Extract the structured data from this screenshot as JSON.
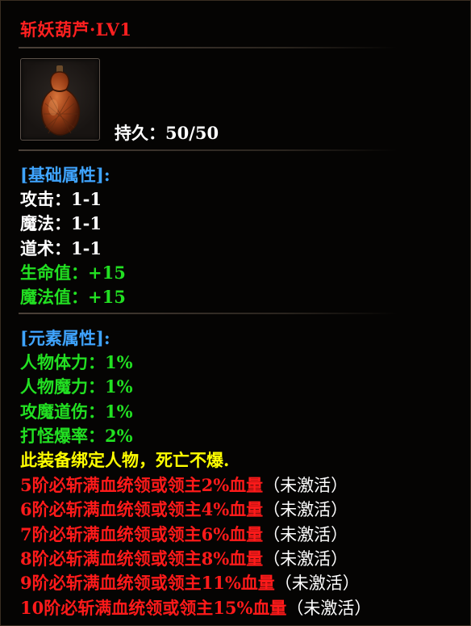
{
  "item": {
    "name": "斩妖葫芦·LV1",
    "durability_label": "持久：",
    "durability_value": "50/50"
  },
  "basic": {
    "header": "[基础属性]:",
    "rows": [
      {
        "label": "攻击：",
        "value": "1-1"
      },
      {
        "label": "魔法：",
        "value": "1-1"
      },
      {
        "label": "道术：",
        "value": "1-1"
      },
      {
        "label": "生命值：",
        "value": "+15"
      },
      {
        "label": "魔法值：",
        "value": "+15"
      }
    ]
  },
  "element": {
    "header": "[元素属性]:",
    "rows": [
      {
        "label": "人物体力：",
        "value": "1%"
      },
      {
        "label": "人物魔力：",
        "value": "1%"
      },
      {
        "label": "攻魔道伤：",
        "value": "1%"
      },
      {
        "label": "打怪爆率：",
        "value": "2%"
      }
    ]
  },
  "binding_note": "此装备绑定人物，死亡不爆.",
  "set_bonuses": [
    {
      "text": "5阶必斩满血统领或领主2%血量",
      "status": "（未激活）"
    },
    {
      "text": "6阶必斩满血统领或领主4%血量",
      "status": "（未激活）"
    },
    {
      "text": "7阶必斩满血统领或领主6%血量",
      "status": "（未激活）"
    },
    {
      "text": "8阶必斩满血统领或领主8%血量",
      "status": "（未激活）"
    },
    {
      "text": "9阶必斩满血统领或领主11%血量",
      "status": "（未激活）"
    },
    {
      "text": "10阶必斩满血统领或领主15%血量",
      "status": "（未激活）"
    }
  ],
  "colors": {
    "title": "#ff2020",
    "header": "#3fa4ff",
    "bonus_stat": "#22e022",
    "note": "#ffff00",
    "set_bonus": "#ff1a1a"
  },
  "icon": "gourd-icon"
}
